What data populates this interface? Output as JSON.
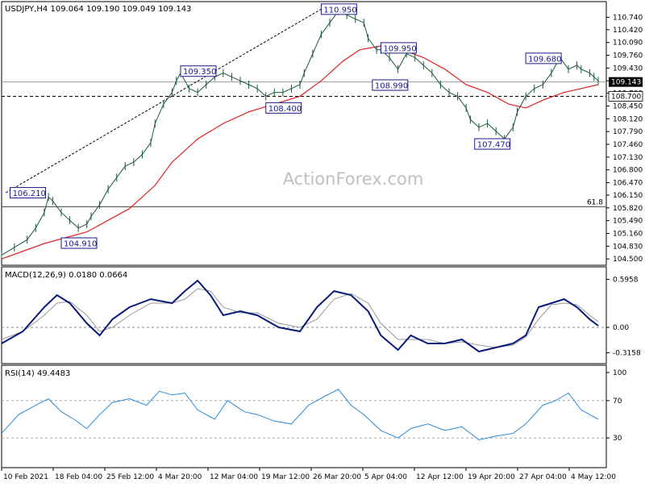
{
  "chart_data": [
    {
      "type": "line",
      "panel": "price",
      "title": "USDJPY,H4  109.064 109.190 109.049 109.143",
      "watermark": "ActionForex.com",
      "y_ticks": [
        "110.740",
        "110.420",
        "110.090",
        "109.760",
        "109.430",
        "109.100",
        "108.780",
        "108.450",
        "108.120",
        "107.790",
        "107.460",
        "107.130",
        "106.800",
        "106.470",
        "106.150",
        "105.820",
        "105.490",
        "105.160",
        "104.830",
        "104.500"
      ],
      "ylim": [
        104.4,
        111.02
      ],
      "x_ticks": [
        "10 Feb 2021",
        "18 Feb 04:00",
        "25 Feb 12:00",
        "4 Mar 20:00",
        "12 Mar 04:00",
        "19 Mar 12:00",
        "26 Mar 20:00",
        "5 Apr 04:00",
        "12 Apr 12:00",
        "19 Apr 20:00",
        "27 Apr 04:00",
        "4 May 12:00"
      ],
      "x_range": [
        0,
        22
      ],
      "current_price": "109.143",
      "levels": [
        {
          "value": 109.07,
          "label": "",
          "style": "solid-gray"
        },
        {
          "value": 108.7,
          "label": "108.700",
          "style": "dashed"
        },
        {
          "value": 105.85,
          "label": "61.8",
          "style": "solid"
        }
      ],
      "annotations": [
        {
          "label": "110.950",
          "x": 7.5,
          "value": 110.95
        },
        {
          "label": "109.350",
          "x": 4.2,
          "value": 109.35
        },
        {
          "label": "106.210",
          "x": 0.2,
          "value": 106.21
        },
        {
          "label": "104.910",
          "x": 1.4,
          "value": 104.91
        },
        {
          "label": "108.400",
          "x": 6.2,
          "value": 108.4
        },
        {
          "label": "109.950",
          "x": 8.9,
          "value": 109.95
        },
        {
          "label": "108.990",
          "x": 8.7,
          "value": 108.99
        },
        {
          "label": "107.470",
          "x": 11.1,
          "value": 107.47
        },
        {
          "label": "109.680",
          "x": 12.3,
          "value": 109.68
        }
      ],
      "trendline": [
        [
          0.1,
          106.21
        ],
        [
          7.5,
          110.95
        ]
      ],
      "series": [
        {
          "values": [
            [
              0,
              104.6
            ],
            [
              0.3,
              104.8
            ],
            [
              0.6,
              105.0
            ],
            [
              0.8,
              105.3
            ],
            [
              1.0,
              105.7
            ],
            [
              1.1,
              106.1
            ],
            [
              1.2,
              106.0
            ],
            [
              1.4,
              105.7
            ],
            [
              1.6,
              105.5
            ],
            [
              1.8,
              105.3
            ],
            [
              2.0,
              105.4
            ],
            [
              2.1,
              105.6
            ],
            [
              2.3,
              105.9
            ],
            [
              2.5,
              106.3
            ],
            [
              2.7,
              106.6
            ],
            [
              2.9,
              106.9
            ],
            [
              3.1,
              107.0
            ],
            [
              3.3,
              107.2
            ],
            [
              3.5,
              107.5
            ],
            [
              3.6,
              108.0
            ],
            [
              3.8,
              108.5
            ],
            [
              4.0,
              108.8
            ],
            [
              4.1,
              109.1
            ],
            [
              4.2,
              109.3
            ],
            [
              4.4,
              108.9
            ],
            [
              4.6,
              108.8
            ],
            [
              4.8,
              109.0
            ],
            [
              5.0,
              109.2
            ],
            [
              5.2,
              109.3
            ],
            [
              5.4,
              109.2
            ],
            [
              5.6,
              109.1
            ],
            [
              5.8,
              109.0
            ],
            [
              6.0,
              108.9
            ],
            [
              6.2,
              108.7
            ],
            [
              6.4,
              108.8
            ],
            [
              6.6,
              108.8
            ],
            [
              6.8,
              108.9
            ],
            [
              7.0,
              109.0
            ],
            [
              7.1,
              109.3
            ],
            [
              7.3,
              109.8
            ],
            [
              7.5,
              110.3
            ],
            [
              7.7,
              110.6
            ],
            [
              7.9,
              110.9
            ],
            [
              8.1,
              110.8
            ],
            [
              8.3,
              110.7
            ],
            [
              8.5,
              110.6
            ],
            [
              8.6,
              110.2
            ],
            [
              8.8,
              109.9
            ],
            [
              8.9,
              109.9
            ],
            [
              9.1,
              109.7
            ],
            [
              9.3,
              109.4
            ],
            [
              9.5,
              109.8
            ],
            [
              9.7,
              109.7
            ],
            [
              9.9,
              109.5
            ],
            [
              10.1,
              109.3
            ],
            [
              10.3,
              109.0
            ],
            [
              10.5,
              108.8
            ],
            [
              10.7,
              108.7
            ],
            [
              10.9,
              108.4
            ],
            [
              11.0,
              108.1
            ],
            [
              11.2,
              107.9
            ],
            [
              11.4,
              108.0
            ],
            [
              11.6,
              107.8
            ],
            [
              11.8,
              107.6
            ],
            [
              12.0,
              107.9
            ],
            [
              12.1,
              108.3
            ],
            [
              12.3,
              108.7
            ],
            [
              12.5,
              108.9
            ],
            [
              12.7,
              109.0
            ],
            [
              12.9,
              109.3
            ],
            [
              13.1,
              109.7
            ],
            [
              13.3,
              109.4
            ],
            [
              13.5,
              109.5
            ],
            [
              13.6,
              109.4
            ],
            [
              13.8,
              109.3
            ],
            [
              13.9,
              109.2
            ],
            [
              14.0,
              109.1
            ]
          ]
        }
      ],
      "ma_series": [
        [
          0,
          104.5
        ],
        [
          1.0,
          104.9
        ],
        [
          2.0,
          105.2
        ],
        [
          3.0,
          105.8
        ],
        [
          3.6,
          106.4
        ],
        [
          4.0,
          107.0
        ],
        [
          4.6,
          107.6
        ],
        [
          5.2,
          108.0
        ],
        [
          5.8,
          108.3
        ],
        [
          6.4,
          108.5
        ],
        [
          7.0,
          108.7
        ],
        [
          7.5,
          109.1
        ],
        [
          8.0,
          109.6
        ],
        [
          8.4,
          109.9
        ],
        [
          8.9,
          110.0
        ],
        [
          9.4,
          109.9
        ],
        [
          9.9,
          109.7
        ],
        [
          10.4,
          109.4
        ],
        [
          10.9,
          109.0
        ],
        [
          11.4,
          108.8
        ],
        [
          11.9,
          108.5
        ],
        [
          12.3,
          108.4
        ],
        [
          12.7,
          108.6
        ],
        [
          13.2,
          108.8
        ],
        [
          13.6,
          108.9
        ],
        [
          14.0,
          109.0
        ]
      ]
    },
    {
      "type": "line",
      "panel": "macd",
      "title": "MACD(12,26,9) 0.0180 0.0664",
      "y_ticks": [
        "0.5958",
        "0.00",
        "-0.3158"
      ],
      "ylim": [
        -0.42,
        0.66
      ],
      "series": [
        {
          "name": "MACD",
          "values": [
            [
              0,
              -0.2
            ],
            [
              0.5,
              -0.05
            ],
            [
              1.0,
              0.25
            ],
            [
              1.3,
              0.4
            ],
            [
              1.6,
              0.3
            ],
            [
              2.0,
              0.05
            ],
            [
              2.3,
              -0.1
            ],
            [
              2.6,
              0.1
            ],
            [
              3.0,
              0.25
            ],
            [
              3.5,
              0.35
            ],
            [
              4.0,
              0.3
            ],
            [
              4.3,
              0.45
            ],
            [
              4.6,
              0.58
            ],
            [
              4.9,
              0.4
            ],
            [
              5.2,
              0.15
            ],
            [
              5.6,
              0.2
            ],
            [
              6.0,
              0.15
            ],
            [
              6.5,
              0.0
            ],
            [
              7.0,
              -0.05
            ],
            [
              7.4,
              0.25
            ],
            [
              7.8,
              0.45
            ],
            [
              8.2,
              0.4
            ],
            [
              8.6,
              0.2
            ],
            [
              8.9,
              -0.1
            ],
            [
              9.3,
              -0.28
            ],
            [
              9.6,
              -0.1
            ],
            [
              10.0,
              -0.2
            ],
            [
              10.4,
              -0.2
            ],
            [
              10.8,
              -0.15
            ],
            [
              11.2,
              -0.3
            ],
            [
              11.6,
              -0.25
            ],
            [
              12.0,
              -0.2
            ],
            [
              12.3,
              -0.1
            ],
            [
              12.6,
              0.25
            ],
            [
              12.9,
              0.3
            ],
            [
              13.2,
              0.35
            ],
            [
              13.5,
              0.25
            ],
            [
              13.8,
              0.1
            ],
            [
              14.0,
              0.02
            ]
          ]
        },
        {
          "name": "Signal",
          "values": [
            [
              0,
              -0.15
            ],
            [
              0.5,
              -0.05
            ],
            [
              1.0,
              0.15
            ],
            [
              1.3,
              0.3
            ],
            [
              1.6,
              0.32
            ],
            [
              2.0,
              0.15
            ],
            [
              2.3,
              -0.05
            ],
            [
              2.6,
              0.0
            ],
            [
              3.0,
              0.15
            ],
            [
              3.5,
              0.3
            ],
            [
              4.0,
              0.3
            ],
            [
              4.3,
              0.35
            ],
            [
              4.6,
              0.48
            ],
            [
              4.9,
              0.45
            ],
            [
              5.2,
              0.25
            ],
            [
              5.6,
              0.18
            ],
            [
              6.0,
              0.18
            ],
            [
              6.5,
              0.05
            ],
            [
              7.0,
              0.0
            ],
            [
              7.4,
              0.1
            ],
            [
              7.8,
              0.35
            ],
            [
              8.2,
              0.42
            ],
            [
              8.6,
              0.3
            ],
            [
              8.9,
              0.05
            ],
            [
              9.3,
              -0.15
            ],
            [
              9.6,
              -0.15
            ],
            [
              10.0,
              -0.15
            ],
            [
              10.4,
              -0.2
            ],
            [
              10.8,
              -0.18
            ],
            [
              11.2,
              -0.22
            ],
            [
              11.6,
              -0.25
            ],
            [
              12.0,
              -0.22
            ],
            [
              12.3,
              -0.12
            ],
            [
              12.6,
              0.1
            ],
            [
              12.9,
              0.28
            ],
            [
              13.2,
              0.3
            ],
            [
              13.5,
              0.28
            ],
            [
              13.8,
              0.15
            ],
            [
              14.0,
              0.07
            ]
          ]
        }
      ]
    },
    {
      "type": "line",
      "panel": "rsi",
      "title": "RSI(14) 49.4483",
      "y_ticks": [
        "100",
        "70",
        "30"
      ],
      "ylim": [
        0,
        100
      ],
      "levels": [
        70,
        30
      ],
      "series": [
        {
          "name": "RSI",
          "values": [
            [
              0,
              35
            ],
            [
              0.4,
              55
            ],
            [
              0.8,
              65
            ],
            [
              1.1,
              72
            ],
            [
              1.4,
              58
            ],
            [
              1.7,
              50
            ],
            [
              2.0,
              40
            ],
            [
              2.3,
              55
            ],
            [
              2.6,
              68
            ],
            [
              3.0,
              72
            ],
            [
              3.4,
              65
            ],
            [
              3.7,
              80
            ],
            [
              4.0,
              76
            ],
            [
              4.3,
              78
            ],
            [
              4.6,
              60
            ],
            [
              5.0,
              50
            ],
            [
              5.3,
              70
            ],
            [
              5.7,
              58
            ],
            [
              6.0,
              55
            ],
            [
              6.4,
              48
            ],
            [
              6.8,
              45
            ],
            [
              7.2,
              65
            ],
            [
              7.6,
              75
            ],
            [
              7.9,
              82
            ],
            [
              8.2,
              65
            ],
            [
              8.5,
              55
            ],
            [
              8.9,
              38
            ],
            [
              9.3,
              30
            ],
            [
              9.6,
              40
            ],
            [
              10.0,
              45
            ],
            [
              10.4,
              38
            ],
            [
              10.8,
              42
            ],
            [
              11.2,
              28
            ],
            [
              11.6,
              32
            ],
            [
              12.0,
              35
            ],
            [
              12.3,
              45
            ],
            [
              12.7,
              65
            ],
            [
              13.0,
              70
            ],
            [
              13.3,
              78
            ],
            [
              13.6,
              60
            ],
            [
              14.0,
              50
            ]
          ]
        }
      ]
    }
  ]
}
